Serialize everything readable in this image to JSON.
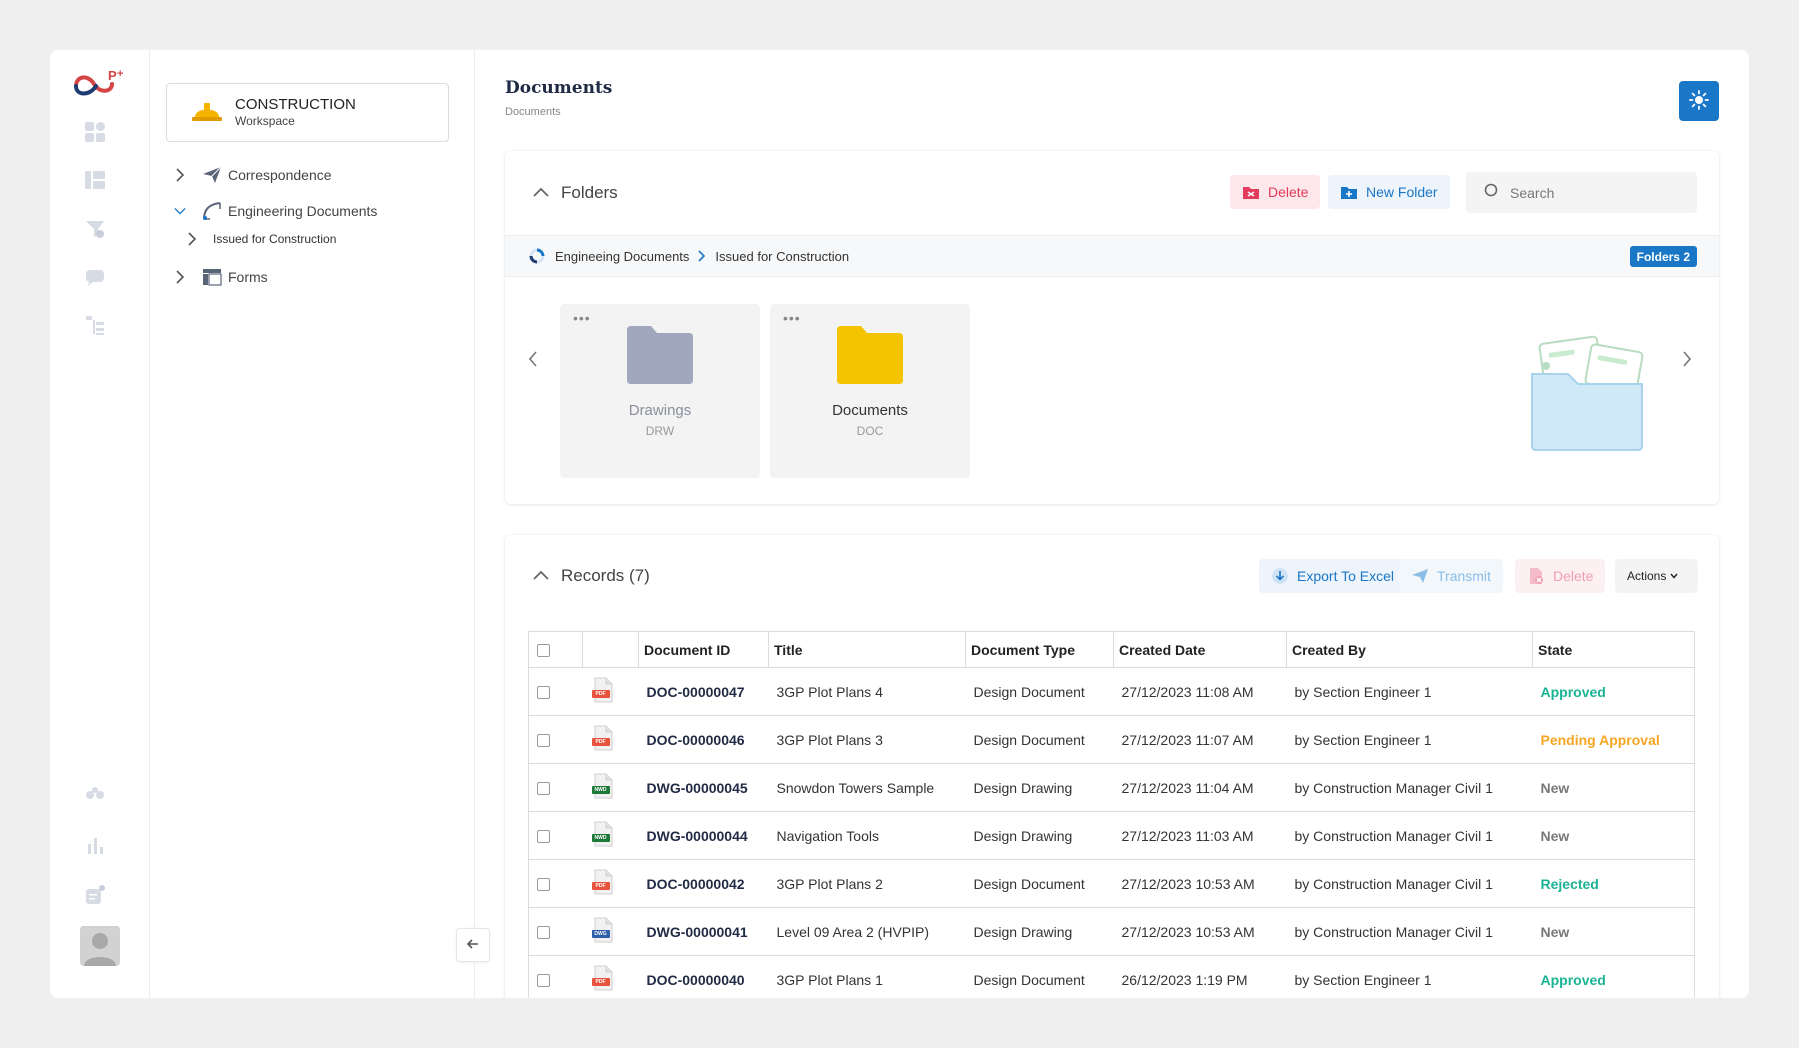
{
  "workspace": {
    "title": "CONSTRUCTION",
    "subtitle": "Workspace"
  },
  "tree": {
    "items": [
      {
        "label": "Correspondence"
      },
      {
        "label": "Engineering Documents"
      },
      {
        "label": "Issued for Construction"
      },
      {
        "label": "Forms"
      }
    ]
  },
  "page": {
    "title": "Documents",
    "breadcrumb": "Documents"
  },
  "folders": {
    "title": "Folders",
    "delete_label": "Delete",
    "new_folder_label": "New Folder",
    "search_placeholder": "Search",
    "path": [
      "Engineeing Documents",
      "Issued for Construction"
    ],
    "badge": "Folders 2",
    "tiles": [
      {
        "name": "Drawings",
        "code": "DRW",
        "color": "#a0a7bd"
      },
      {
        "name": "Documents",
        "code": "DOC",
        "color": "#f5c400"
      }
    ]
  },
  "records": {
    "title": "Records (7)",
    "export_label": "Export To Excel",
    "transmit_label": "Transmit",
    "delete_label": "Delete",
    "actions_label": "Actions",
    "columns": [
      "Document ID",
      "Title",
      "Document Type",
      "Created Date",
      "Created By",
      "State"
    ],
    "rows": [
      {
        "file": "PDF",
        "id": "DOC-00000047",
        "title": "3GP Plot Plans 4",
        "type": "Design Document",
        "date": "27/12/2023 11:08 AM",
        "by": "by Section Engineer 1",
        "state": "Approved",
        "state_class": "st-approved"
      },
      {
        "file": "PDF",
        "id": "DOC-00000046",
        "title": "3GP Plot Plans 3",
        "type": "Design Document",
        "date": "27/12/2023 11:07 AM",
        "by": "by Section Engineer 1",
        "state": "Pending Approval",
        "state_class": "st-pending"
      },
      {
        "file": "NWD",
        "id": "DWG-00000045",
        "title": "Snowdon Towers Sample",
        "type": "Design Drawing",
        "date": "27/12/2023 11:04 AM",
        "by": "by Construction Manager Civil 1",
        "state": "New",
        "state_class": "st-new"
      },
      {
        "file": "NWD",
        "id": "DWG-00000044",
        "title": "Navigation Tools",
        "type": "Design Drawing",
        "date": "27/12/2023 11:03 AM",
        "by": "by Construction Manager Civil 1",
        "state": "New",
        "state_class": "st-new"
      },
      {
        "file": "PDF",
        "id": "DOC-00000042",
        "title": "3GP Plot Plans 2",
        "type": "Design Document",
        "date": "27/12/2023 10:53 AM",
        "by": "by Construction Manager Civil 1",
        "state": "Rejected",
        "state_class": "st-rejected"
      },
      {
        "file": "DWG",
        "id": "DWG-00000041",
        "title": "Level 09 Area 2 (HVPIP)",
        "type": "Design Drawing",
        "date": "27/12/2023 10:53 AM",
        "by": "by Construction Manager Civil 1",
        "state": "New",
        "state_class": "st-new"
      },
      {
        "file": "PDF",
        "id": "DOC-00000040",
        "title": "3GP Plot Plans 1",
        "type": "Design Document",
        "date": "26/12/2023 1:19 PM",
        "by": "by Section Engineer 1",
        "state": "Approved",
        "state_class": "st-approved"
      }
    ]
  },
  "colors": {
    "accent": "#1a76c6",
    "approved": "#1bb394",
    "pending": "#f5a623",
    "danger": "#e23b5c"
  }
}
